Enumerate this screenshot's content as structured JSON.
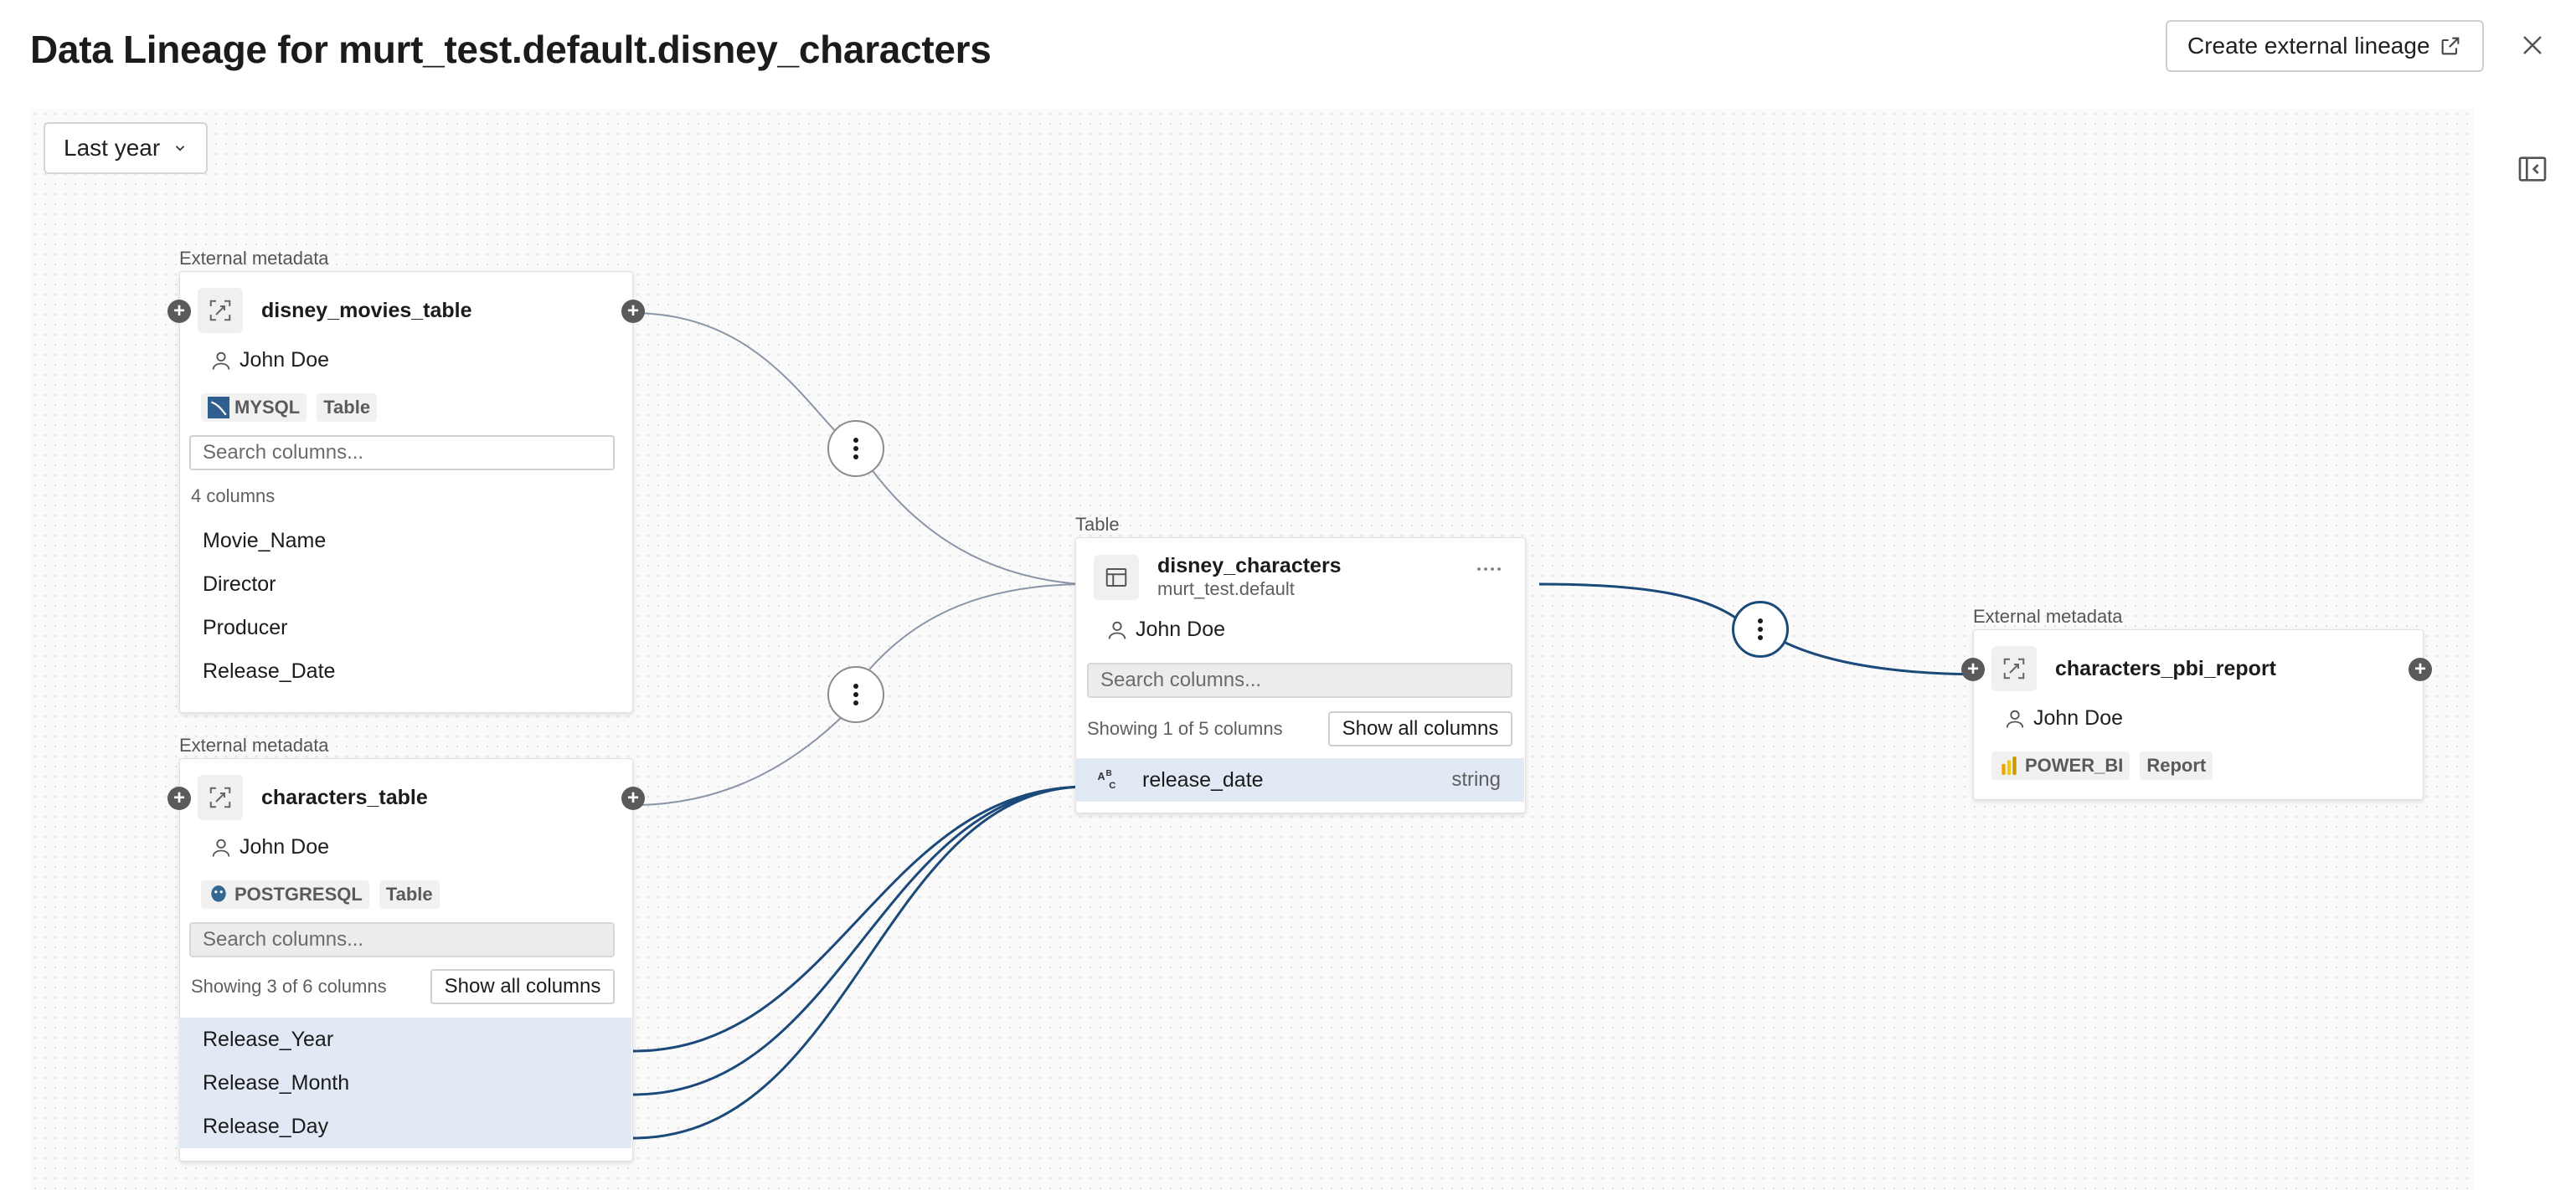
{
  "header": {
    "title": "Data Lineage for murt_test.default.disney_characters",
    "external_button": "Create external lineage"
  },
  "filter": {
    "selected": "Last year"
  },
  "nodes": {
    "movies": {
      "section": "External metadata",
      "name": "disney_movies_table",
      "owner": "John Doe",
      "badges": [
        "MYSQL",
        "Table"
      ],
      "search_placeholder": "Search columns...",
      "count": "4 columns",
      "columns": [
        "Movie_Name",
        "Director",
        "Producer",
        "Release_Date"
      ]
    },
    "characters_table": {
      "section": "External metadata",
      "name": "characters_table",
      "owner": "John Doe",
      "badges": [
        "POSTGRESQL",
        "Table"
      ],
      "search_placeholder": "Search columns...",
      "count": "Showing 3 of 6 columns",
      "show_all": "Show all columns",
      "columns": [
        "Release_Year",
        "Release_Month",
        "Release_Day"
      ]
    },
    "main": {
      "section": "Table",
      "name": "disney_characters",
      "schema": "murt_test.default",
      "owner": "John Doe",
      "search_placeholder": "Search columns...",
      "count": "Showing 1 of 5 columns",
      "show_all": "Show all columns",
      "columns": [
        {
          "name": "release_date",
          "type": "string"
        }
      ]
    },
    "report": {
      "section": "External metadata",
      "name": "characters_pbi_report",
      "owner": "John Doe",
      "badges": [
        "POWER_BI",
        "Report"
      ]
    }
  },
  "colors": {
    "edge_default": "#8a96a8",
    "edge_active": "#1b4a7a",
    "highlight": "#e1e9f4"
  }
}
